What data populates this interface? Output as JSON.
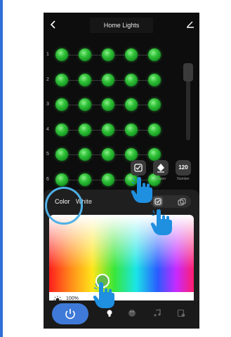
{
  "header": {
    "title": "Home Lights"
  },
  "grid": {
    "rows": [
      "1",
      "2",
      "3",
      "4",
      "5",
      "6"
    ],
    "columns": 5
  },
  "tools": [
    {
      "name": "select",
      "label": ""
    },
    {
      "name": "eraser",
      "label": "Eraser"
    },
    {
      "name": "number",
      "value": "120",
      "label": "Number"
    }
  ],
  "panel": {
    "tabs": [
      "Color",
      "White"
    ],
    "brightness": "100%"
  },
  "colors": {
    "accent": "#3f7ad8",
    "led": "#33c23a",
    "highlight": "#4fb0e6"
  },
  "icons": [
    "back-icon",
    "edit-icon",
    "select-tool-icon",
    "eraser-icon",
    "sun-icon",
    "power-icon",
    "bulb-icon",
    "palette-icon",
    "music-icon",
    "schedule-icon",
    "hand-pointer-icon"
  ]
}
